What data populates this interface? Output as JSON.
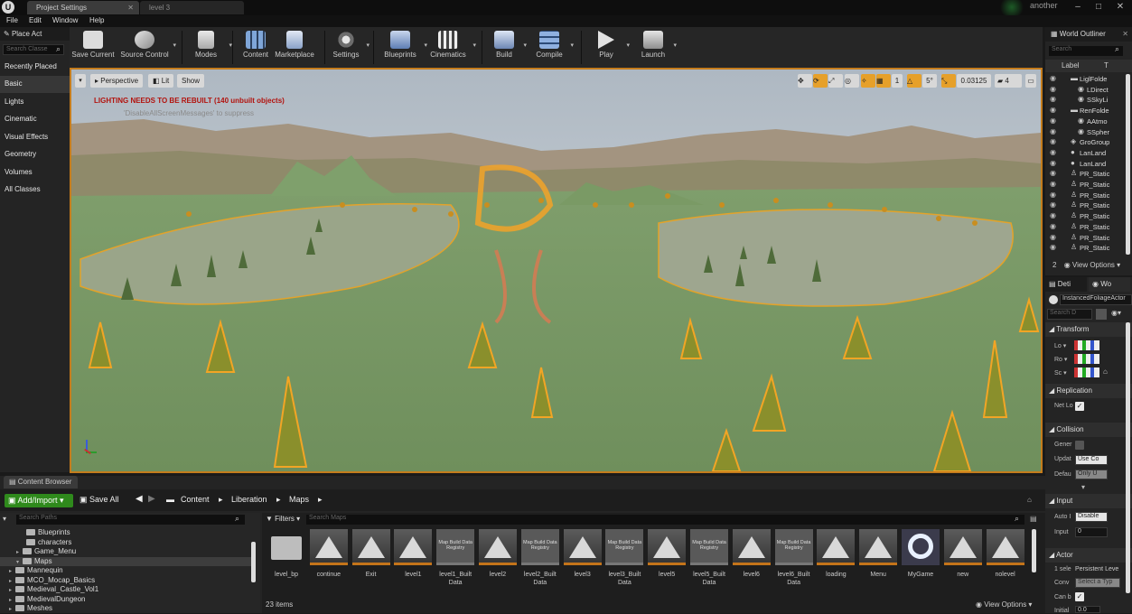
{
  "title_bar": {
    "tabs": [
      "Project Settings",
      "level 3"
    ],
    "user": "another"
  },
  "menu": [
    "File",
    "Edit",
    "Window",
    "Help"
  ],
  "toolbar": [
    {
      "label": "Save Current",
      "icon": "save-icon"
    },
    {
      "label": "Source Control",
      "icon": "source-control-icon"
    },
    {
      "label": "Modes",
      "icon": "modes-icon"
    },
    {
      "label": "Content",
      "icon": "content-icon"
    },
    {
      "label": "Marketplace",
      "icon": "marketplace-icon"
    },
    {
      "label": "Settings",
      "icon": "settings-icon"
    },
    {
      "label": "Blueprints",
      "icon": "blueprints-icon"
    },
    {
      "label": "Cinematics",
      "icon": "cinematics-icon"
    },
    {
      "label": "Build",
      "icon": "build-icon"
    },
    {
      "label": "Compile",
      "icon": "compile-icon"
    },
    {
      "label": "Play",
      "icon": "play-icon"
    },
    {
      "label": "Launch",
      "icon": "launch-icon"
    }
  ],
  "place_actors": {
    "header": "Place Act",
    "search_placeholder": "Search Classe",
    "items": [
      "Recently Placed",
      "Basic",
      "Lights",
      "Cinematic",
      "Visual Effects",
      "Geometry",
      "Volumes",
      "All Classes"
    ],
    "selected": "Basic"
  },
  "viewport": {
    "perspective": "Perspective",
    "lit": "Lit",
    "show": "Show",
    "warning": "LIGHTING NEEDS TO BE REBUILT (140 unbuilt objects)",
    "suppress": "'DisableAllScreenMessages' to suppress",
    "grid_size": "1",
    "rotation_snap": "5°",
    "scale_snap": "0.03125",
    "camera_speed": "4"
  },
  "world_outliner": {
    "header": "World Outliner",
    "search_placeholder": "Search",
    "col_label": "Label",
    "col_type": "T",
    "rows": [
      "LiglFolde",
      "LDirect",
      "SSkyLi",
      "RenFolde",
      "AAtmo",
      "SSpher",
      "GroGroup",
      "LanLand",
      "LanLand",
      "PR_Static",
      "PR_Static",
      "PR_Static",
      "PR_Static",
      "PR_Static",
      "PR_Static",
      "PR_Static",
      "PR_Static"
    ],
    "count": "2",
    "view_options": "View Options"
  },
  "details": {
    "tab1": "Deti",
    "tab2": "Wo",
    "actor_name": "InstancedFoliageActor",
    "search_placeholder": "Search D",
    "transform": "Transform",
    "location": "Lo",
    "rotation": "Ro",
    "scale": "Sc",
    "replication": "Replication",
    "net_load": "Net Lo",
    "collision": "Collision",
    "generate": "Gener",
    "update": "Updat",
    "update_value": "Use Co",
    "default": "Defau",
    "default_value": "Only U",
    "input": "Input",
    "auto_input": "Auto I",
    "auto_value": "Disable",
    "input_label": "Input",
    "input_value": "0",
    "actor": "Actor",
    "selected": "1 sele",
    "persistent": "Persistent Leve",
    "convert": "Conv",
    "select_type": "Select a Typ",
    "can_be": "Can b",
    "initial": "Initial",
    "initial_value": "0.0"
  },
  "content_browser": {
    "tab": "Content Browser",
    "add_import": "Add/Import",
    "save_all": "Save All",
    "breadcrumb": [
      "Content",
      "Liberation",
      "Maps"
    ],
    "paths_placeholder": "Search Paths",
    "folders": [
      "Blueprints",
      "characters",
      "Game_Menu",
      "Maps",
      "Mannequin",
      "MCO_Mocap_Basics",
      "Medieval_Castle_Vol1",
      "MedievalDungeon",
      "Meshes"
    ],
    "filters": "Filters",
    "maps_placeholder": "Search Maps",
    "assets": [
      {
        "name": "level_bp",
        "kind": "folder"
      },
      {
        "name": "continue",
        "kind": "map"
      },
      {
        "name": "Exit",
        "kind": "map"
      },
      {
        "name": "level1",
        "kind": "map"
      },
      {
        "name": "level1_Built Data",
        "kind": "registry"
      },
      {
        "name": "level2",
        "kind": "map"
      },
      {
        "name": "level2_Built Data",
        "kind": "registry"
      },
      {
        "name": "level3",
        "kind": "map"
      },
      {
        "name": "level3_Built Data",
        "kind": "registry"
      },
      {
        "name": "level5",
        "kind": "map"
      },
      {
        "name": "level5_Built Data",
        "kind": "registry"
      },
      {
        "name": "level6",
        "kind": "map"
      },
      {
        "name": "level6_Built Data",
        "kind": "registry"
      },
      {
        "name": "loading",
        "kind": "map"
      },
      {
        "name": "Menu",
        "kind": "map"
      },
      {
        "name": "MyGame",
        "kind": "game"
      },
      {
        "name": "new",
        "kind": "map"
      },
      {
        "name": "nolevel",
        "kind": "map"
      }
    ],
    "registry_label": "Map Build Data Registry",
    "item_count": "23 items",
    "view_options": "View Options"
  }
}
